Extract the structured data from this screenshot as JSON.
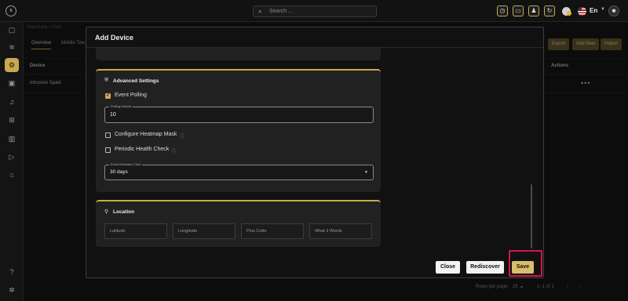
{
  "topbar": {
    "logo": "x",
    "search_placeholder": "Search ...",
    "language": "En",
    "icons": [
      "clock-icon",
      "laptop-icon",
      "user-icon",
      "refresh-icon"
    ]
  },
  "sidebar": {
    "icons": [
      "monitor-icon",
      "layers-icon",
      "settings-icon",
      "camera-icon",
      "bell-icon",
      "network-icon",
      "map-icon",
      "play-icon",
      "building-icon",
      "help-icon",
      "gear-icon"
    ]
  },
  "page": {
    "breadcrumb": [
      "Gaystrata",
      ">",
      "Defi..."
    ],
    "tabs": [
      "Overview",
      "Mobile Tow"
    ],
    "buttons": [
      "Export",
      "Add New",
      "Import"
    ],
    "table": {
      "headers": [
        "Device",
        "Actions"
      ],
      "rows": [
        {
          "device": "Intrusion Spain",
          "actions": "•••"
        }
      ]
    },
    "footer": {
      "rows_per_page_label": "Rows per page:",
      "rows_per_page": "25",
      "range": "1–1 of 1"
    }
  },
  "modal": {
    "title": "Add Device",
    "advanced": {
      "title": "Advanced Settings",
      "event_polling": {
        "label": "Event Polling",
        "checked": true
      },
      "polling_interval": {
        "legend": "Polling Interval",
        "value": "10"
      },
      "heatmap": {
        "label": "Configure Heatmap Mask",
        "checked": false
      },
      "health": {
        "label": "Periodic Health Check",
        "checked": false
      },
      "retention": {
        "legend": "Event Retention Time",
        "value": "30 days"
      }
    },
    "location": {
      "title": "Location",
      "fields": [
        {
          "placeholder": "Latitude"
        },
        {
          "placeholder": "Longitude"
        },
        {
          "placeholder": "Plus Code"
        },
        {
          "placeholder": "What 3 Words"
        }
      ]
    },
    "buttons": {
      "close": "Close",
      "rediscover": "Rediscover",
      "save": "Save"
    }
  },
  "colors": {
    "accent": "#c9a84e",
    "highlight": "#d0174a",
    "save": "#d9bd6a"
  }
}
